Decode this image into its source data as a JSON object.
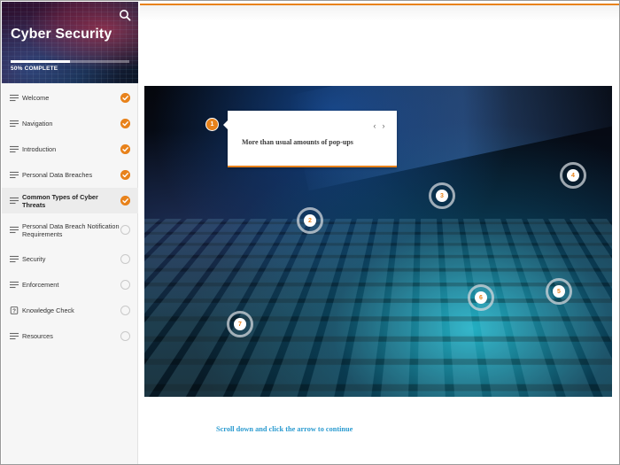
{
  "course": {
    "title": "Cyber Security",
    "progress_label": "50% COMPLETE",
    "progress_fraction": 0.5
  },
  "header": {
    "search_icon": "search-icon"
  },
  "sidebar": {
    "items": [
      {
        "label": "Welcome",
        "status": "complete",
        "icon": "lines-icon"
      },
      {
        "label": "Navigation",
        "status": "complete",
        "icon": "lines-icon"
      },
      {
        "label": "Introduction",
        "status": "complete",
        "icon": "lines-icon"
      },
      {
        "label": "Personal Data Breaches",
        "status": "complete",
        "icon": "lines-icon"
      },
      {
        "label": "Common Types of Cyber Threats",
        "status": "complete",
        "icon": "lines-icon",
        "active": true
      },
      {
        "label": "Personal Data Breach Notification Requirements",
        "status": "incomplete",
        "icon": "lines-icon"
      },
      {
        "label": "Security",
        "status": "incomplete",
        "icon": "lines-icon"
      },
      {
        "label": "Enforcement",
        "status": "incomplete",
        "icon": "lines-icon"
      },
      {
        "label": "Knowledge Check",
        "status": "incomplete",
        "icon": "question-icon"
      },
      {
        "label": "Resources",
        "status": "incomplete",
        "icon": "lines-icon"
      }
    ]
  },
  "labeled_graphic": {
    "hotspots": [
      "1",
      "2",
      "3",
      "4",
      "5",
      "6",
      "7"
    ],
    "popup": {
      "text": "More than usual amounts of pop-ups",
      "prev_glyph": "‹",
      "next_glyph": "›"
    }
  },
  "footer": {
    "continue_text": "Scroll down and click the arrow to continue"
  },
  "colors": {
    "accent": "#e8821b",
    "link": "#2b9bd0"
  }
}
